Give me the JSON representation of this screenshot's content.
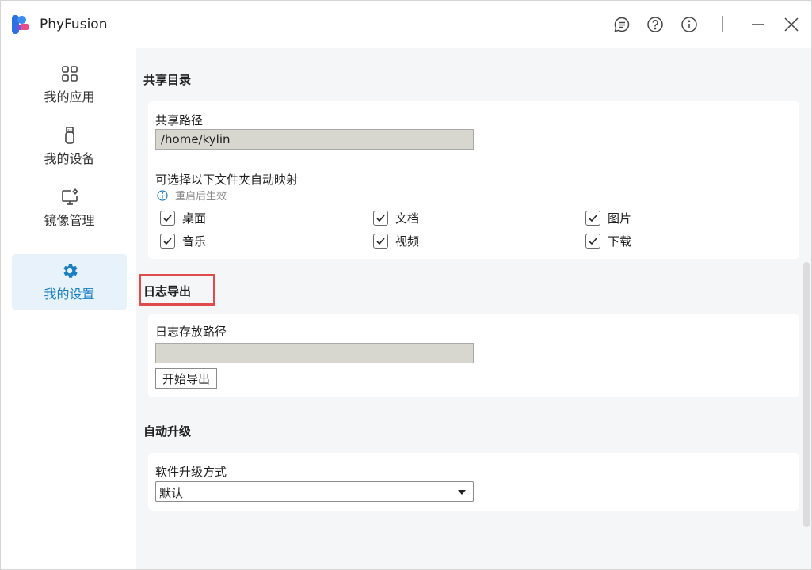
{
  "app": {
    "title": "PhyFusion"
  },
  "nav": {
    "items": [
      {
        "label": "我的应用",
        "icon": "grid-icon"
      },
      {
        "label": "我的设备",
        "icon": "usb-drive-icon"
      },
      {
        "label": "镜像管理",
        "icon": "monitor-settings-icon"
      },
      {
        "label": "我的设置",
        "icon": "gear-icon",
        "active": true
      }
    ]
  },
  "titlebar": {
    "icons": [
      "feedback-icon",
      "help-icon",
      "info-icon",
      "minimize-icon",
      "close-icon"
    ]
  },
  "share": {
    "section_title": "共享目录",
    "path_label": "共享路径",
    "path_value": "/home/kylin",
    "auto_map_label": "可选择以下文件夹自动映射",
    "hint": "重启后生效",
    "folders": [
      {
        "label": "桌面",
        "checked": true
      },
      {
        "label": "文档",
        "checked": true
      },
      {
        "label": "图片",
        "checked": true
      },
      {
        "label": "音乐",
        "checked": true
      },
      {
        "label": "视频",
        "checked": true
      },
      {
        "label": "下载",
        "checked": true
      }
    ]
  },
  "log": {
    "section_title": "日志导出",
    "path_label": "日志存放路径",
    "path_value": "",
    "export_button": "开始导出"
  },
  "upgrade": {
    "section_title": "自动升级",
    "method_label": "软件升级方式",
    "method_value": "默认"
  },
  "colors": {
    "accent": "#1a7fc2",
    "active_nav_bg": "#e8f2fa",
    "highlight": "#e04b4b",
    "input_bg": "#d7d7cf"
  }
}
